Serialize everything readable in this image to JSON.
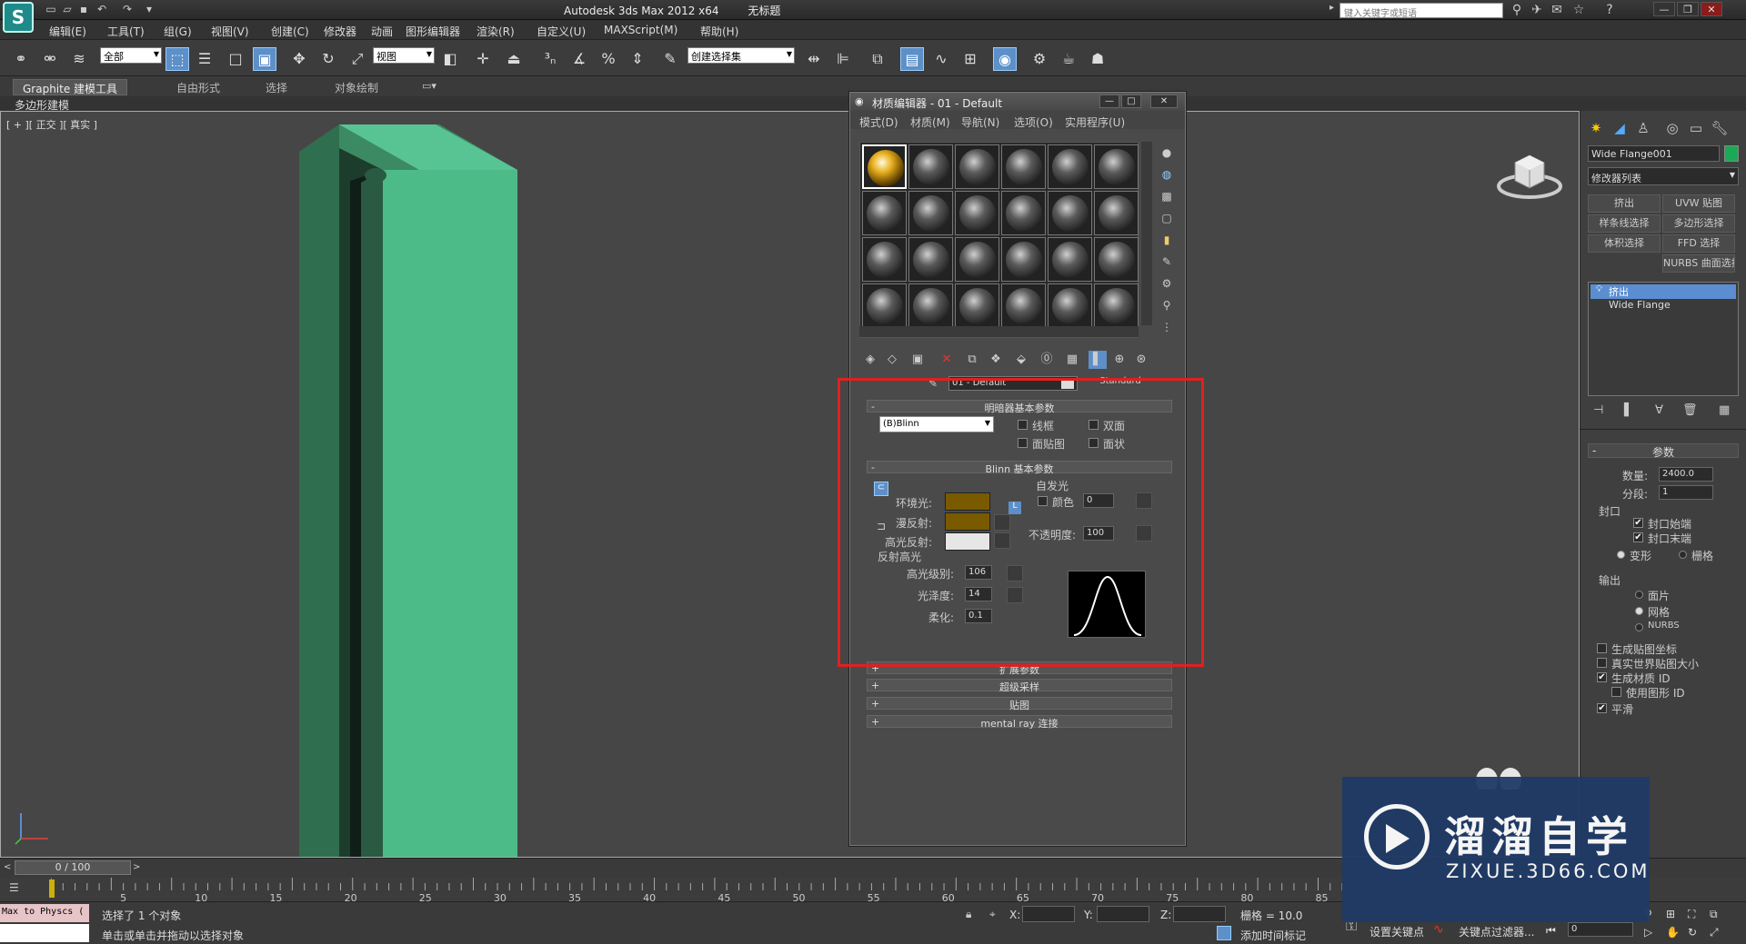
{
  "app": {
    "logo": "S",
    "title": "Autodesk 3ds Max  2012 x64",
    "doc": "无标题",
    "search_placeholder": "键入关键字或短语",
    "quick_access_icons": [
      "new-icon",
      "open-icon",
      "save-icon",
      "undo-icon",
      "redo-icon",
      "dropdown-icon"
    ]
  },
  "menu": [
    "编辑(E)",
    "工具(T)",
    "组(G)",
    "视图(V)",
    "创建(C)",
    "修改器",
    "动画",
    "图形编辑器",
    "渲染(R)",
    "自定义(U)",
    "MAXScript(M)",
    "帮助(H)"
  ],
  "toolbar": {
    "filter_value": "全部",
    "ref_coord_value": "视图",
    "named_selection_value": "创建选择集"
  },
  "ribbon": {
    "tabs": [
      "Graphite 建模工具",
      "自由形式",
      "选择",
      "对象绘制"
    ],
    "sub_label": "多边形建模"
  },
  "viewport": {
    "label": "[ + ][ 正交 ][ 真实 ]",
    "object_color": "#4cbb88"
  },
  "material_editor": {
    "title": "材质编辑器 - 01 - Default",
    "menu": [
      "模式(D)",
      "材质(M)",
      "导航(N)",
      "选项(O)",
      "实用程序(U)"
    ],
    "material_name": "01 - Default",
    "material_type": "Standard",
    "shader_rollout": "明暗器基本参数",
    "shader": "(B)Blinn",
    "checks": {
      "wire": "线框",
      "two_sided": "双面",
      "face_map": "面贴图",
      "faceted": "面状"
    },
    "blinn_rollout": "Blinn 基本参数",
    "self_illum": {
      "group": "自发光",
      "color_label": "颜色",
      "value": "0"
    },
    "ambient_label": "环境光:",
    "diffuse_label": "漫反射:",
    "specular_label": "高光反射:",
    "ambient_color": "#7a5a00",
    "diffuse_color": "#7a5a00",
    "specular_color": "#e6e6e6",
    "opacity_label": "不透明度:",
    "opacity": "100",
    "spec_group": "反射高光",
    "spec_level_label": "高光级别:",
    "spec_level": "106",
    "gloss_label": "光泽度:",
    "gloss": "14",
    "soften_label": "柔化:",
    "soften": "0.1",
    "more_rollouts": [
      "扩展参数",
      "超级采样",
      "贴图",
      "mental ray 连接"
    ],
    "plus": "+",
    "minus": "-"
  },
  "command_panel": {
    "object_name": "Wide Flange001",
    "object_color": "#1aaa55",
    "modifier_list": "修改器列表",
    "modifier_buttons": [
      "挤出",
      "UVW 贴图",
      "样条线选择",
      "多边形选择",
      "体积选择",
      "FFD 选择",
      "NURBS 曲面选择"
    ],
    "stack": [
      "挤出",
      "Wide Flange"
    ],
    "params_rollout": "参数",
    "amount_label": "数量:",
    "amount": "2400.0",
    "segments_label": "分段:",
    "segments": "1",
    "cap_group": "封口",
    "cap_start": "封口始端",
    "cap_end": "封口末端",
    "morph": "变形",
    "grid": "栅格",
    "output_group": "输出",
    "patch": "面片",
    "mesh": "网格",
    "nurbs": "NURBS",
    "gen_map": "生成贴图坐标",
    "real_world": "真实世界贴图大小",
    "gen_mat_id": "生成材质 ID",
    "use_shape_id": "使用图形 ID",
    "smooth": "平滑"
  },
  "timeline": {
    "frame": "0 / 100",
    "ticks": [
      "5",
      "10",
      "15",
      "20",
      "25",
      "30",
      "35",
      "40",
      "45",
      "50",
      "55",
      "60",
      "65",
      "70",
      "75",
      "80",
      "85"
    ]
  },
  "status": {
    "maxscript": "Max to Physcs (",
    "selected": "选择了 1 个对象",
    "prompt": "单击或单击并拖动以选择对象",
    "x_label": "X:",
    "y_label": "Y:",
    "z_label": "Z:",
    "grid": "栅格 = 10.0",
    "add_time_tag": "添加时间标记",
    "set_key": "设置关键点",
    "key_filters": "关键点过滤器...",
    "frame_value": "0"
  },
  "watermark": {
    "text": "溜溜自学",
    "sub": "ZIXUE.3D66.COM"
  }
}
